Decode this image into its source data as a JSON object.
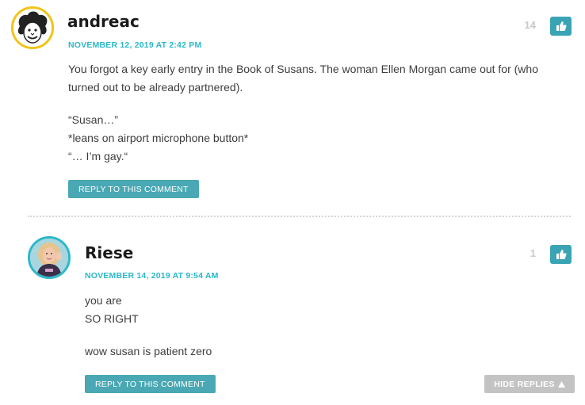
{
  "comments": [
    {
      "author": "andreac",
      "date": "NOVEMBER 12, 2019 AT 2:42 PM",
      "likes": "14",
      "paragraphs": [
        [
          "You forgot a key early entry in the Book of Susans. The woman Ellen Morgan came out for (who",
          "turned out to be already partnered)."
        ],
        [
          "“Susan…”",
          "*leans on airport microphone button*",
          "“… I’m gay.“"
        ]
      ],
      "reply_label": "REPLY TO THIS COMMENT",
      "avatar_icon": "cartoon-face-avatar",
      "avatar_ring_color": "#f2c318"
    },
    {
      "author": "Riese",
      "date": "NOVEMBER 14, 2019 AT 9:54 AM",
      "likes": "1",
      "paragraphs": [
        [
          "you are",
          "SO RIGHT"
        ],
        [
          "wow susan is patient zero"
        ]
      ],
      "reply_label": "REPLY TO THIS COMMENT",
      "avatar_icon": "photo-avatar",
      "avatar_ring_color": "#2cb8c9"
    }
  ],
  "hide_replies_label": "HIDE REPLIES",
  "hide_replies_icon": "triangle-up-icon",
  "like_icon": "thumbs-up-icon",
  "colors": {
    "accent": "#2cb8c9",
    "button": "#49a8b4",
    "like_button": "#3aa4b5",
    "muted_button": "#c3c3c3"
  }
}
